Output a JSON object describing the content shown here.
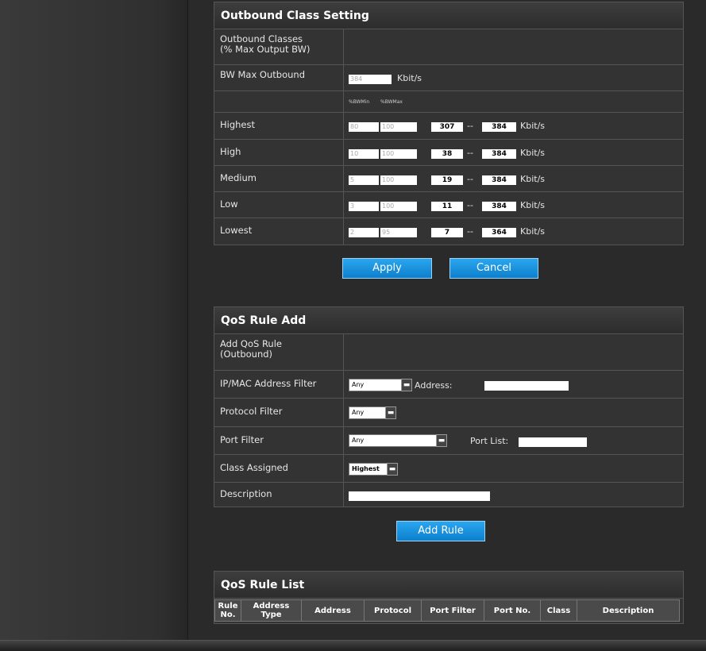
{
  "outbound": {
    "title": "Outbound Class Setting",
    "classes_label": "Outbound Classes\n(% Max Output BW)",
    "bw_label": "BW Max Outbound",
    "bw_value": "384",
    "unit": "Kbit/s",
    "col_min": "%BWMin",
    "col_max": "%BWMax",
    "dash": "--",
    "rows": [
      {
        "label": "Highest",
        "min": "80",
        "max": "100",
        "low": "307",
        "high": "384"
      },
      {
        "label": "High",
        "min": "10",
        "max": "100",
        "low": "38",
        "high": "384"
      },
      {
        "label": "Medium",
        "min": "5",
        "max": "100",
        "low": "19",
        "high": "384"
      },
      {
        "label": "Low",
        "min": "3",
        "max": "100",
        "low": "11",
        "high": "384"
      },
      {
        "label": "Lowest",
        "min": "2",
        "max": "95",
        "low": "7",
        "high": "364"
      }
    ],
    "apply_label": "Apply",
    "cancel_label": "Cancel"
  },
  "qos_add": {
    "title": "QoS Rule Add",
    "add_label": "Add QoS Rule\n(Outbound)",
    "ipmac_label": "IP/MAC Address Filter",
    "ipmac_value": "Any",
    "address_label": "Address:",
    "address_value": "",
    "protocol_label": "Protocol Filter",
    "protocol_value": "Any",
    "port_label": "Port Filter",
    "port_value": "Any",
    "portlist_label": "Port List:",
    "portlist_value": "",
    "class_label": "Class Assigned",
    "class_value": "Highest",
    "desc_label": "Description",
    "desc_value": "",
    "add_rule_label": "Add Rule"
  },
  "qos_list": {
    "title": "QoS Rule List",
    "headers": [
      "Rule\nNo.",
      "Address\nType",
      "Address",
      "Protocol",
      "Port Filter",
      "Port No.",
      "Class",
      "Description"
    ]
  }
}
